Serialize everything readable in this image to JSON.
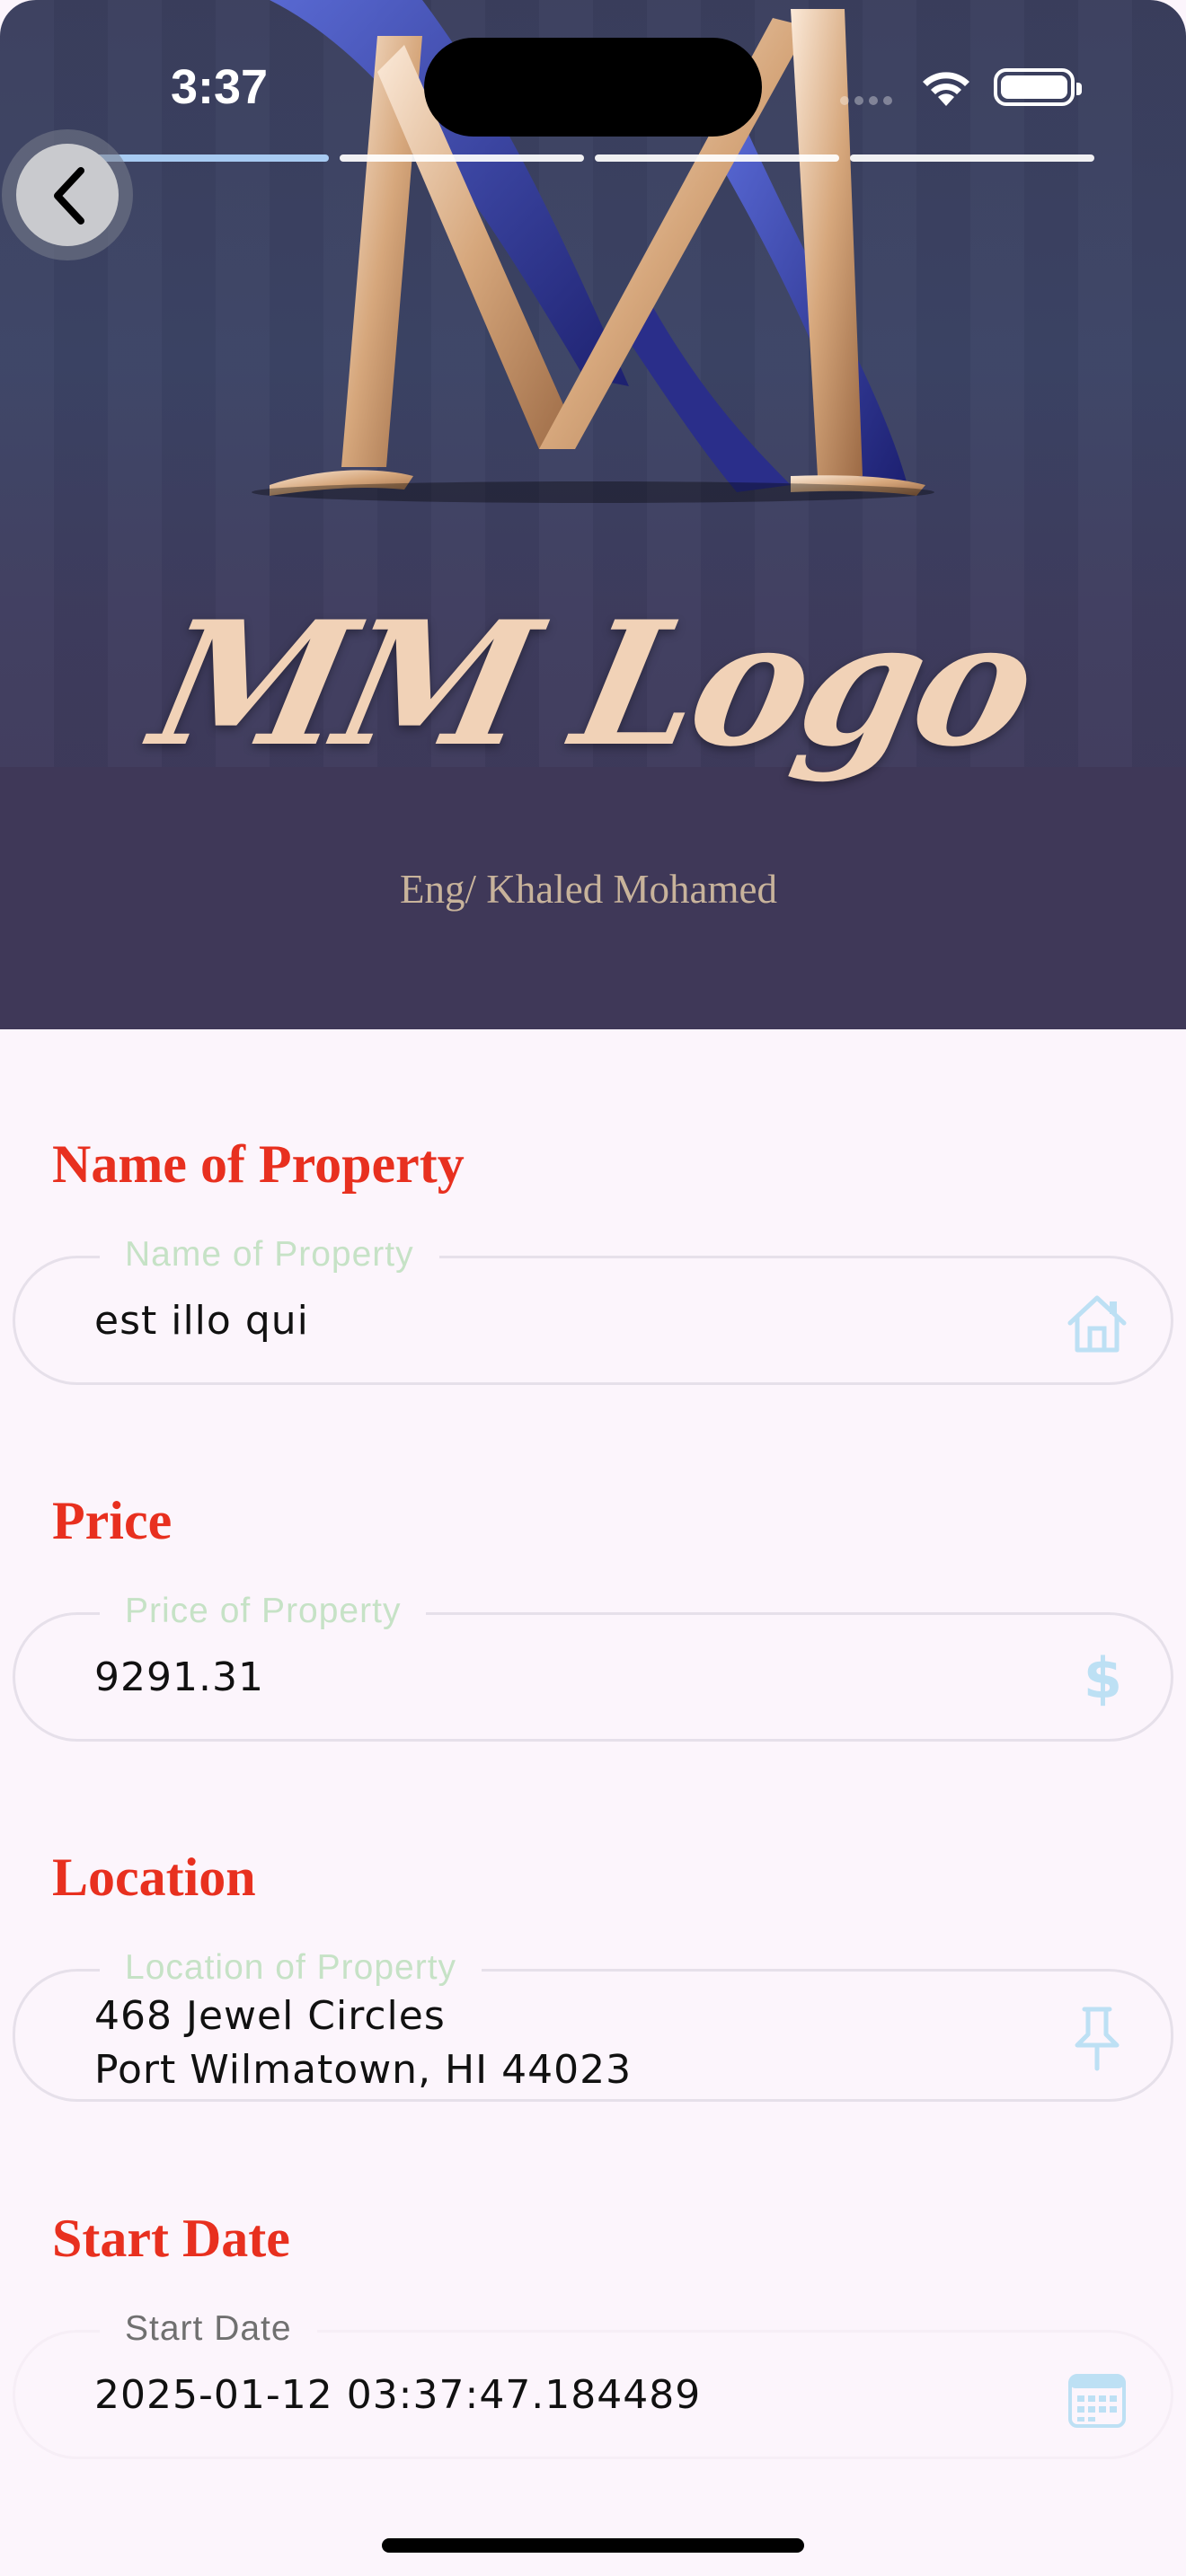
{
  "status_bar": {
    "time": "3:37"
  },
  "hero": {
    "logo_text": "MM Logo",
    "logo_subtitle": "Eng/ Khaled Mohamed",
    "story_progress": {
      "segments": 4,
      "current": 1
    }
  },
  "form": {
    "name_section": {
      "title": "Name of Property",
      "label": "Name of Property",
      "value": "est illo qui",
      "icon": "home-icon"
    },
    "price_section": {
      "title": "Price",
      "label": "Price of Property",
      "value": "9291.31",
      "icon_text": "$"
    },
    "location_section": {
      "title": "Location",
      "label": "Location of Property",
      "value": "468 Jewel Circles\nPort Wilmatown, HI 44023",
      "icon": "pin-icon"
    },
    "start_date_section": {
      "title": "Start Date",
      "label": "Start Date",
      "value": "2025-01-12 03:37:47.184489",
      "icon": "calendar-icon"
    }
  },
  "colors": {
    "section_title": "#e8301f",
    "background": "#fcf5fc",
    "field_label": "#c6e2c6",
    "icon_tint": "#bde0f4"
  }
}
